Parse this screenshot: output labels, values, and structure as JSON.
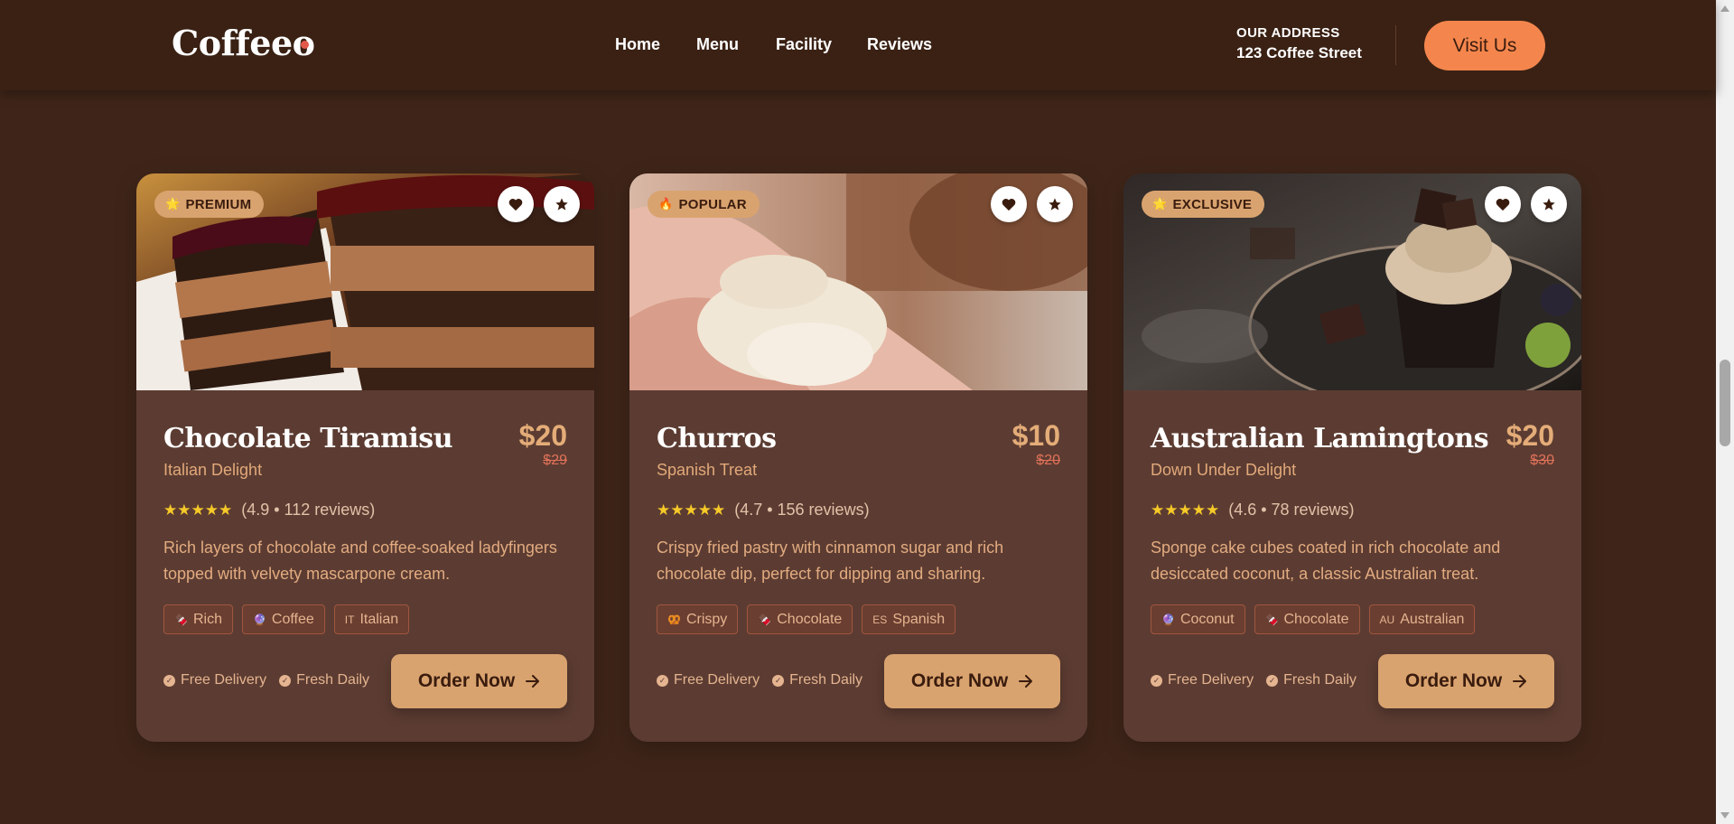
{
  "header": {
    "logo": "Coffeeo",
    "nav": [
      "Home",
      "Menu",
      "Facility",
      "Reviews"
    ],
    "address_title": "OUR ADDRESS",
    "address_value": "123 Coffee Street",
    "cta": "Visit Us"
  },
  "colors": {
    "page_bg": "#3f2519",
    "header_bg": "#3a2114",
    "card_bg": "#5c3c32",
    "accent": "#d9a36f",
    "cta": "#f4864d",
    "star": "#f6c928"
  },
  "products": [
    {
      "badge": "PREMIUM",
      "badge_icon": "star-icon",
      "badge_glyph": "🌟",
      "title": "Chocolate Tiramisu",
      "subtitle": "Italian Delight",
      "price": "$20",
      "old_price": "$29",
      "stars": "★★★★★",
      "rating_text": "(4.9 • 112 reviews)",
      "description": "Rich layers of chocolate and coffee-soaked ladyfingers topped with velvety mascarpone cream.",
      "tags": [
        {
          "label": "Rich",
          "icon": "chocolate-icon",
          "glyph": "🍫"
        },
        {
          "label": "Coffee",
          "icon": "coffee-icon",
          "glyph": "🔮"
        },
        {
          "label": "Italian",
          "icon": "flag-it-icon",
          "glyph": "IT"
        }
      ],
      "features": [
        "Free Delivery",
        "Fresh Daily"
      ],
      "order_label": "Order Now",
      "image": "chocolate-cake-image"
    },
    {
      "badge": "POPULAR",
      "badge_icon": "fire-icon",
      "badge_glyph": "🔥",
      "title": "Churros",
      "subtitle": "Spanish Treat",
      "price": "$10",
      "old_price": "$20",
      "stars": "★★★★★",
      "rating_text": "(4.7 • 156 reviews)",
      "description": "Crispy fried pastry with cinnamon sugar and rich chocolate dip, perfect for dipping and sharing.",
      "tags": [
        {
          "label": "Crispy",
          "icon": "pretzel-icon",
          "glyph": "🥨"
        },
        {
          "label": "Chocolate",
          "icon": "chocolate-icon",
          "glyph": "🍫"
        },
        {
          "label": "Spanish",
          "icon": "flag-es-icon",
          "glyph": "ES"
        }
      ],
      "features": [
        "Free Delivery",
        "Fresh Daily"
      ],
      "order_label": "Order Now",
      "image": "rice-in-hand-image"
    },
    {
      "badge": "EXCLUSIVE",
      "badge_icon": "star-icon",
      "badge_glyph": "🌟",
      "title": "Australian Lamingtons",
      "subtitle": "Down Under Delight",
      "price": "$20",
      "old_price": "$30",
      "stars": "★★★★★",
      "rating_text": "(4.6 • 78 reviews)",
      "description": "Sponge cake cubes coated in rich chocolate and desiccated coconut, a classic Australian treat.",
      "tags": [
        {
          "label": "Coconut",
          "icon": "coconut-icon",
          "glyph": "🔮"
        },
        {
          "label": "Chocolate",
          "icon": "chocolate-icon",
          "glyph": "🍫"
        },
        {
          "label": "Australian",
          "icon": "flag-au-icon",
          "glyph": "AU"
        }
      ],
      "features": [
        "Free Delivery",
        "Fresh Daily"
      ],
      "order_label": "Order Now",
      "image": "chocolate-cupcake-image"
    }
  ]
}
